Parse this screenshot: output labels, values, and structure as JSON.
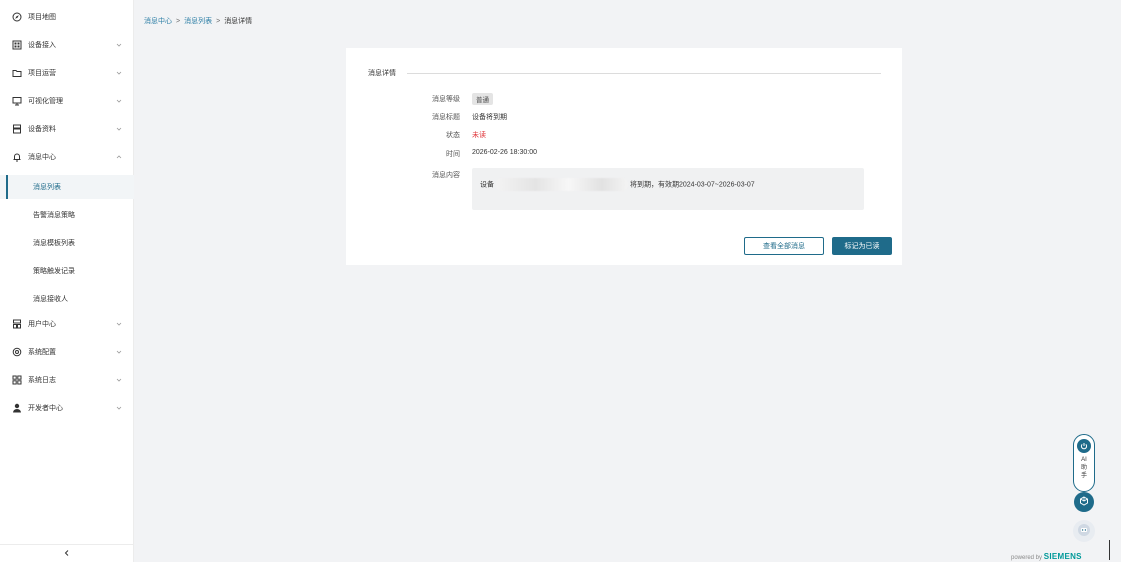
{
  "sidebar": {
    "items": [
      {
        "label": "项目地图",
        "icon": "compass-icon",
        "has_chevron": false
      },
      {
        "label": "设备接入",
        "icon": "device-grid-icon",
        "has_chevron": true
      },
      {
        "label": "项目运营",
        "icon": "folder-icon",
        "has_chevron": true
      },
      {
        "label": "可视化管理",
        "icon": "monitor-icon",
        "has_chevron": true
      },
      {
        "label": "设备资料",
        "icon": "document-stack-icon",
        "has_chevron": true
      },
      {
        "label": "消息中心",
        "icon": "bell-icon",
        "has_chevron": true,
        "expanded": true
      }
    ],
    "sub_items": [
      {
        "label": "消息列表",
        "active": true
      },
      {
        "label": "告警消息策略",
        "active": false
      },
      {
        "label": "消息模板列表",
        "active": false
      },
      {
        "label": "策略触发记录",
        "active": false
      },
      {
        "label": "消息接收人",
        "active": false
      }
    ],
    "items_after": [
      {
        "label": "用户中心",
        "icon": "users-icon"
      },
      {
        "label": "系统配置",
        "icon": "settings-icon"
      },
      {
        "label": "系统日志",
        "icon": "apps-icon"
      },
      {
        "label": "开发者中心",
        "icon": "person-icon"
      }
    ],
    "collapse_icon": "chevron-left-icon"
  },
  "breadcrumb": {
    "items": [
      "消息中心",
      "消息列表",
      "消息详情"
    ],
    "separator": ">"
  },
  "detail": {
    "section_title": "消息详情",
    "fields": {
      "level_label": "消息等级",
      "level_value": "普通",
      "title_label": "消息标题",
      "title_value": "设备将到期",
      "status_label": "状态",
      "status_value": "未读",
      "time_label": "时间",
      "time_value": "2026-02-26 18:30:00",
      "content_label": "消息内容",
      "content_prefix": "设备",
      "content_suffix": "将到期，有效期2024-03-07~2026-03-07"
    },
    "buttons": {
      "view_all": "查看全部消息",
      "mark_read": "标记为已读"
    }
  },
  "widgets": {
    "ai_assistant": "AI助手",
    "powered_prefix": "powered by",
    "powered_brand": "SIEMENS"
  },
  "colors": {
    "accent": "#1f6b8a",
    "link": "#2e7fa6",
    "unread": "#e0393e",
    "brand": "#009999"
  }
}
